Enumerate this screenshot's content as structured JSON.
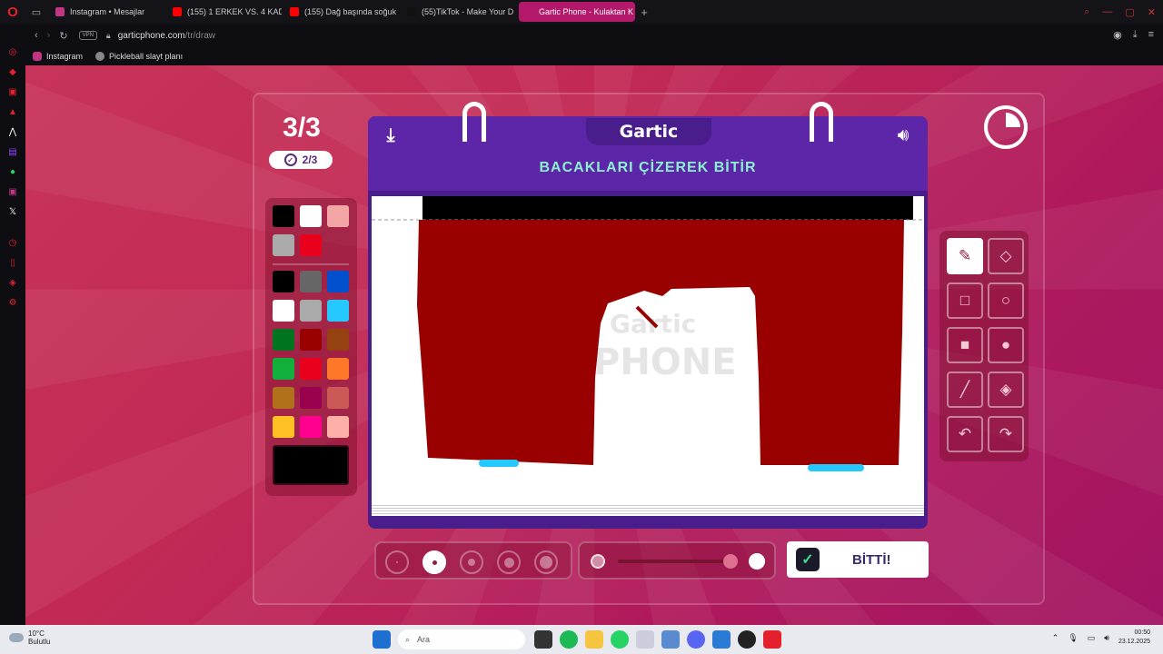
{
  "browser": {
    "tabs": [
      {
        "label": "Instagram • Mesajlar",
        "color": "#c13584",
        "active": false
      },
      {
        "label": "(155) 1 ERKEK VS. 4 KADIN",
        "color": "#ff0000",
        "active": false
      },
      {
        "label": "(155) Dağ başında soğuk",
        "color": "#ff0000",
        "active": false
      },
      {
        "label": "(55)TikTok - Make Your D",
        "color": "#111111",
        "active": false
      },
      {
        "label": "Gartic Phone - Kulaktan K",
        "color": "#b4186b",
        "active": true
      }
    ],
    "url_host": "garticphone.com",
    "url_path": "/tr/draw",
    "vpn_label": "VPN",
    "bookmarks": [
      {
        "label": "Instagram",
        "color": "#c13584"
      },
      {
        "label": "Pickleball slayt planı",
        "color": "#888888"
      }
    ]
  },
  "game": {
    "round": "3/3",
    "subround": "2/3",
    "logo": "Gartic",
    "task": "BACAKLARI ÇİZEREK BİTİR",
    "done_label": "BİTTİ!",
    "palette_top": [
      "#000000",
      "#ffffff",
      "#f4a6a6",
      "#aaaaaa",
      "#e8001c"
    ],
    "palette_main": [
      "#000000",
      "#666666",
      "#0050cd",
      "#ffffff",
      "#aaaaaa",
      "#26c9ff",
      "#017420",
      "#990000",
      "#964112",
      "#11b03c",
      "#e8001c",
      "#ff7829",
      "#b0701c",
      "#99004e",
      "#cb5a57",
      "#ffc126",
      "#ff008f",
      "#feafa8"
    ],
    "current_color": "#000000",
    "tools": [
      "pencil-icon",
      "eraser-icon",
      "square-outline-icon",
      "circle-outline-icon",
      "square-filled-icon",
      "circle-filled-icon",
      "line-icon",
      "bucket-icon",
      "undo-icon",
      "redo-icon"
    ],
    "active_tool": "pencil-icon",
    "brush_sizes": 5,
    "active_size": 2
  },
  "taskbar": {
    "weather_temp": "10°C",
    "weather_desc": "Bulutlu",
    "search_placeholder": "Ara",
    "time": "00:50",
    "date": "23.12.2025"
  }
}
